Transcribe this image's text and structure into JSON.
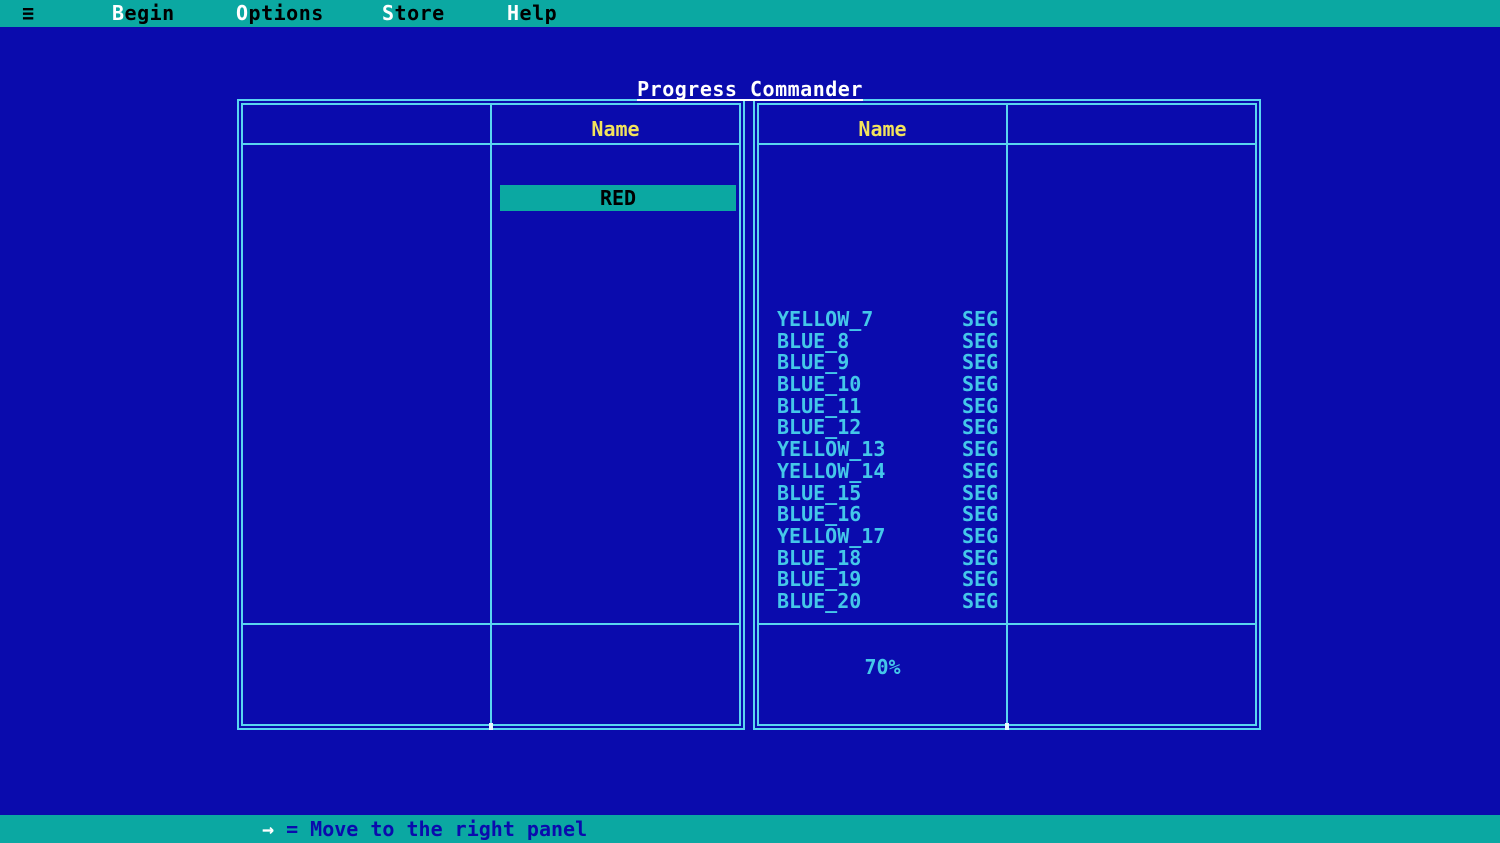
{
  "title": "Progress Commander",
  "menu": {
    "hamburger": "≡",
    "items": [
      {
        "label": "Begin",
        "hotkey": "B",
        "rest": "egin"
      },
      {
        "label": "Options",
        "hotkey": "O",
        "rest": "ptions"
      },
      {
        "label": "Store",
        "hotkey": "S",
        "rest": "tore"
      },
      {
        "label": "Help",
        "hotkey": "H",
        "rest": "elp"
      }
    ]
  },
  "left_panel": {
    "name_header": "Name",
    "selected_item": "RED"
  },
  "right_panel": {
    "name_header": "Name",
    "items": [
      {
        "name": "YELLOW_7",
        "type": "SEG"
      },
      {
        "name": "BLUE_8",
        "type": "SEG"
      },
      {
        "name": "BLUE_9",
        "type": "SEG"
      },
      {
        "name": "BLUE_10",
        "type": "SEG"
      },
      {
        "name": "BLUE_11",
        "type": "SEG"
      },
      {
        "name": "BLUE_12",
        "type": "SEG"
      },
      {
        "name": "YELLOW_13",
        "type": "SEG"
      },
      {
        "name": "YELLOW_14",
        "type": "SEG"
      },
      {
        "name": "BLUE_15",
        "type": "SEG"
      },
      {
        "name": "BLUE_16",
        "type": "SEG"
      },
      {
        "name": "YELLOW_17",
        "type": "SEG"
      },
      {
        "name": "BLUE_18",
        "type": "SEG"
      },
      {
        "name": "BLUE_19",
        "type": "SEG"
      },
      {
        "name": "BLUE_20",
        "type": "SEG"
      }
    ],
    "footer_percent": "70%"
  },
  "status_bar": {
    "arrow": "→",
    "text": "= Move to the right panel"
  },
  "colors": {
    "background": "#0a0bad",
    "bar_teal": "#0ba8a2",
    "border_cyan": "#5ad5f0",
    "text_cyan": "#44c7e9",
    "header_yellow": "#f2e35c",
    "title_white": "#ffffff",
    "menu_text_black": "#000000"
  }
}
